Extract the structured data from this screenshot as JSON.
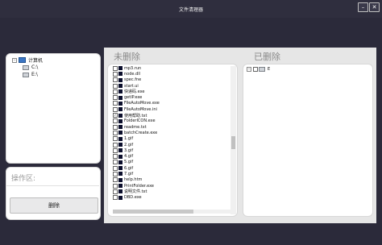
{
  "window": {
    "title": "文件清理器",
    "minimize_label": "–",
    "close_label": "✕"
  },
  "tree": {
    "root": {
      "expander": "−",
      "label": "计算机"
    },
    "drives": [
      "C:\\",
      "E:\\"
    ]
  },
  "operations": {
    "title": "操作区:",
    "delete_label": "删除"
  },
  "pending": {
    "label": "未删除",
    "files": [
      {
        "name": "mp3.run",
        "checked": false
      },
      {
        "name": "node.dll",
        "checked": false
      },
      {
        "name": "spec.fne",
        "checked": false
      },
      {
        "name": "start.ui",
        "checked": false
      },
      {
        "name": "快递码.exe",
        "checked": false
      },
      {
        "name": "getIP.exe",
        "checked": false
      },
      {
        "name": "FileAutoMove.exe",
        "checked": false
      },
      {
        "name": "FileAutoMove.ini",
        "checked": false
      },
      {
        "name": "使用帮助.txt",
        "checked": true
      },
      {
        "name": "FolderICON.exe",
        "checked": false
      },
      {
        "name": "readme.txt",
        "checked": false
      },
      {
        "name": "batchCreate.exe",
        "checked": false
      },
      {
        "name": "1.gif",
        "checked": false
      },
      {
        "name": "2.gif",
        "checked": false
      },
      {
        "name": "3.gif",
        "checked": false
      },
      {
        "name": "4.gif",
        "checked": false
      },
      {
        "name": "5.gif",
        "checked": false
      },
      {
        "name": "6.gif",
        "checked": false
      },
      {
        "name": "7.gif",
        "checked": false
      },
      {
        "name": "help.htm",
        "checked": false
      },
      {
        "name": "PrintFolder.exe",
        "checked": false
      },
      {
        "name": "说明文件.txt",
        "checked": false
      },
      {
        "name": "DBD.exe",
        "checked": false
      }
    ]
  },
  "deleted": {
    "label": "已删除",
    "items": [
      {
        "expander": "−",
        "name": "E"
      }
    ]
  },
  "colors": {
    "background": "#2b2a3a",
    "panel": "#e6e6e6",
    "list_bg": "#ffffff",
    "pc_icon": "#3b76c4"
  }
}
